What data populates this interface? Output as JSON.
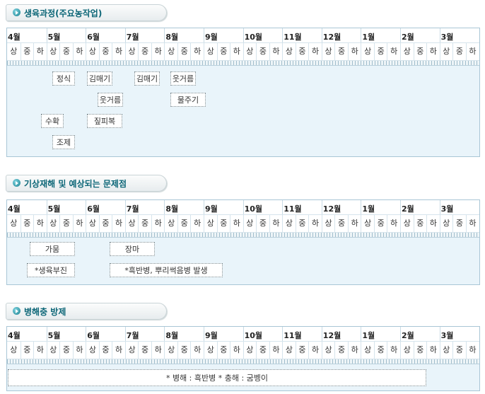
{
  "months": [
    "4월",
    "5월",
    "6월",
    "7월",
    "8월",
    "9월",
    "10월",
    "11월",
    "12월",
    "1월",
    "2월",
    "3월"
  ],
  "thirds": [
    "상",
    "중",
    "하"
  ],
  "sections": [
    {
      "title": "생육과정(주요농작업)",
      "tasks": [
        {
          "label": "정식"
        },
        {
          "label": "김매기"
        },
        {
          "label": "김매기"
        },
        {
          "label": "웃거름"
        },
        {
          "label": "웃거름"
        },
        {
          "label": "물주기"
        },
        {
          "label": "수확"
        },
        {
          "label": "짚피복"
        },
        {
          "label": "조제"
        }
      ]
    },
    {
      "title": "기상재해 및 예상되는 문제점",
      "tasks": [
        {
          "label": "가뭄"
        },
        {
          "label": "장마"
        },
        {
          "label": "*생육부진"
        },
        {
          "label": "*흑반병, 뿌리썩음병 발생"
        }
      ]
    },
    {
      "title": "병해충 방제",
      "tasks": [
        {
          "label": "* 병해 : 흑반병 * 충해 : 굼벵이"
        }
      ]
    }
  ]
}
